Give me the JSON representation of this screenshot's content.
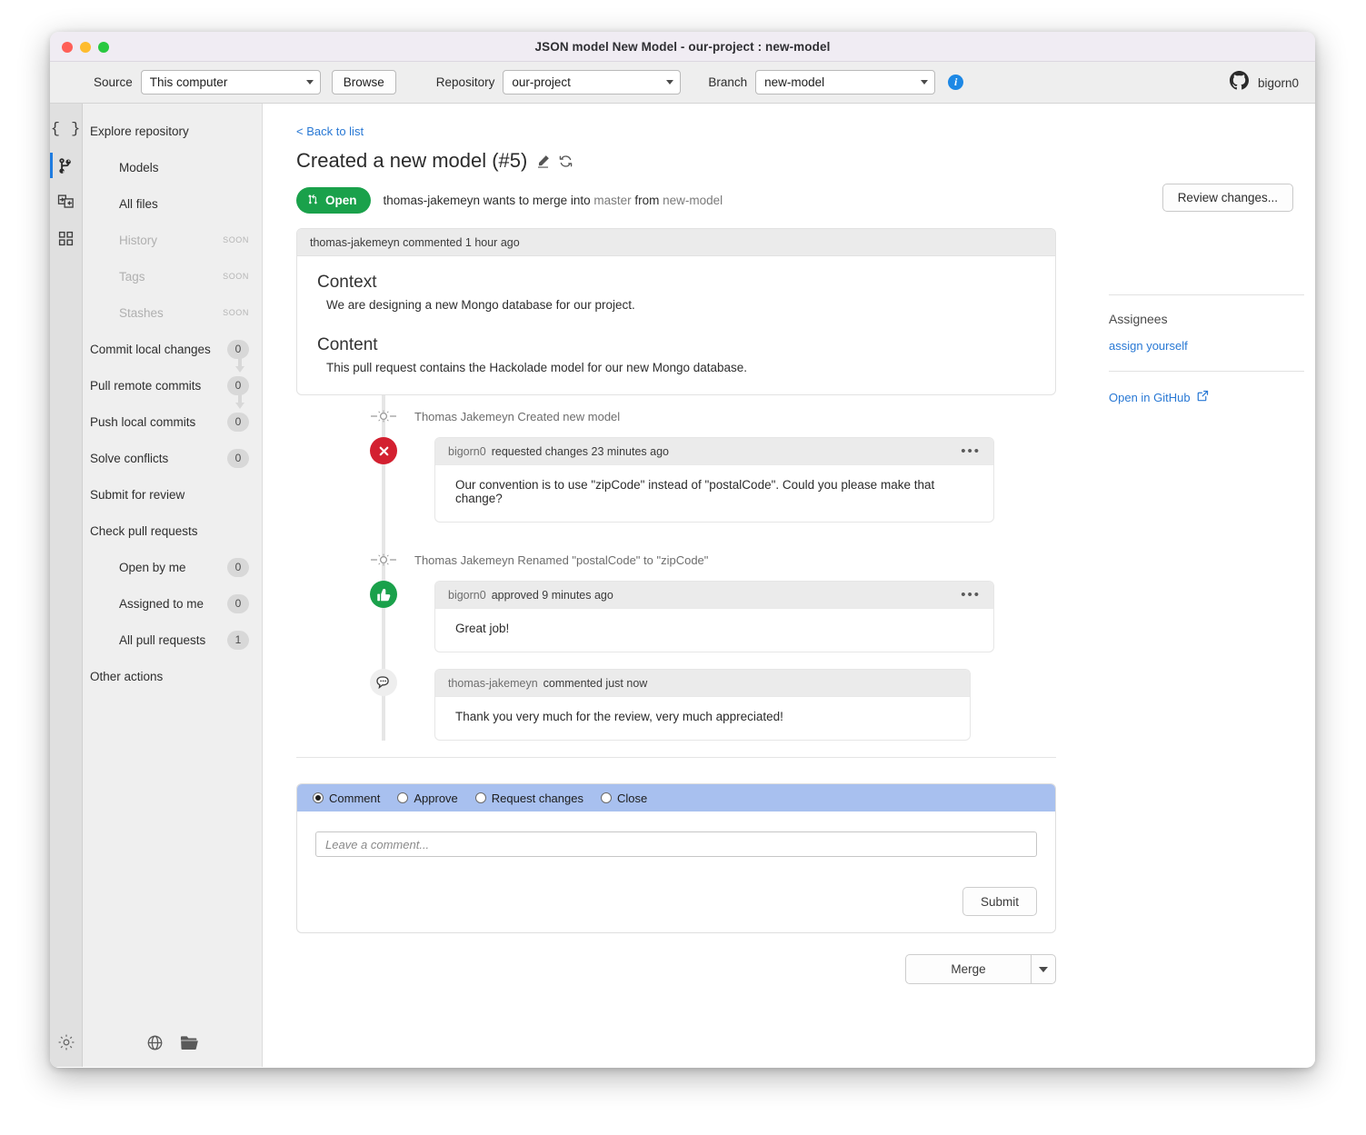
{
  "window": {
    "title": "JSON model New Model - our-project : new-model"
  },
  "toolbar": {
    "source_label": "Source",
    "source_value": "This computer",
    "browse_label": "Browse",
    "repository_label": "Repository",
    "repository_value": "our-project",
    "branch_label": "Branch",
    "branch_value": "new-model",
    "info_glyph": "i",
    "user_name": "bigorn0",
    "github_icon": "github-icon"
  },
  "rail": {
    "items": [
      {
        "name": "json-braces-icon",
        "glyph": "{ }"
      },
      {
        "name": "git-branch-icon"
      },
      {
        "name": "compare-models-icon"
      },
      {
        "name": "grid-apps-icon"
      }
    ],
    "settings_icon": "gear-icon"
  },
  "nav": {
    "items": [
      {
        "label": "Explore repository",
        "level": 0,
        "badge": null,
        "soon": false,
        "disabled": false,
        "connector": false
      },
      {
        "label": "Models",
        "level": 1,
        "badge": null,
        "soon": false,
        "disabled": false,
        "connector": false
      },
      {
        "label": "All files",
        "level": 1,
        "badge": null,
        "soon": false,
        "disabled": false,
        "connector": false
      },
      {
        "label": "History",
        "level": 1,
        "badge": null,
        "soon": true,
        "disabled": true,
        "connector": false
      },
      {
        "label": "Tags",
        "level": 1,
        "badge": null,
        "soon": true,
        "disabled": true,
        "connector": false
      },
      {
        "label": "Stashes",
        "level": 1,
        "badge": null,
        "soon": true,
        "disabled": true,
        "connector": false
      },
      {
        "label": "Commit local changes",
        "level": 0,
        "badge": "0",
        "soon": false,
        "disabled": false,
        "connector": true
      },
      {
        "label": "Pull remote commits",
        "level": 0,
        "badge": "0",
        "soon": false,
        "disabled": false,
        "connector": true
      },
      {
        "label": "Push local commits",
        "level": 0,
        "badge": "0",
        "soon": false,
        "disabled": false,
        "connector": false
      },
      {
        "label": "Solve conflicts",
        "level": 0,
        "badge": "0",
        "soon": false,
        "disabled": false,
        "connector": false
      },
      {
        "label": "Submit for review",
        "level": 0,
        "badge": null,
        "soon": false,
        "disabled": false,
        "connector": false
      },
      {
        "label": "Check pull requests",
        "level": 0,
        "badge": null,
        "soon": false,
        "disabled": false,
        "connector": false
      },
      {
        "label": "Open by me",
        "level": 1,
        "badge": "0",
        "soon": false,
        "disabled": false,
        "connector": false
      },
      {
        "label": "Assigned to me",
        "level": 1,
        "badge": "0",
        "soon": false,
        "disabled": false,
        "connector": false
      },
      {
        "label": "All pull requests",
        "level": 1,
        "badge": "1",
        "soon": false,
        "disabled": false,
        "connector": false
      },
      {
        "label": "Other actions",
        "level": 0,
        "badge": null,
        "soon": false,
        "disabled": false,
        "connector": false
      }
    ],
    "bottom_icons": [
      {
        "name": "globe-icon"
      },
      {
        "name": "folder-icon"
      }
    ]
  },
  "main": {
    "back_link": "< Back to list",
    "pr_title": "Created a new model (#5)",
    "edit_icon": "pencil-edit-icon",
    "refresh_icon": "refresh-sync-icon",
    "status_badge": "Open",
    "merge_prefix": "thomas-jakemeyn wants to merge into ",
    "merge_base": "master",
    "merge_mid": " from ",
    "merge_head": "new-model",
    "review_button": "Review changes...",
    "description": {
      "header": "thomas-jakemeyn commented 1 hour ago",
      "sections": [
        {
          "heading": "Context",
          "text": "We are designing a new Mongo database for our project."
        },
        {
          "heading": "Content",
          "text": "This pull request contains the Hackolade model for our new Mongo database."
        }
      ]
    },
    "timeline": [
      {
        "kind": "commit",
        "marker": "commit-node-icon",
        "text": "Thomas Jakemeyn Created new model"
      },
      {
        "kind": "event",
        "marker": "changes-requested-icon",
        "marker_color": "#d32030",
        "marker_glyph": "✕",
        "who": "bigorn0",
        "action": "requested changes 23 minutes ago",
        "menu": "•••",
        "body": "Our convention is to use \"zipCode\" instead of \"postalCode\". Could you please make that change?"
      },
      {
        "kind": "commit",
        "marker": "commit-node-icon",
        "text": "Thomas Jakemeyn Renamed \"postalCode\" to \"zipCode\""
      },
      {
        "kind": "event",
        "marker": "approved-thumbs-up-icon",
        "marker_color": "#1aa14b",
        "marker_glyph": "👍",
        "who": "bigorn0",
        "action": "approved 9 minutes ago",
        "menu": "•••",
        "body": "Great job!"
      },
      {
        "kind": "event",
        "marker": "comment-bubble-icon",
        "marker_color": "#eeeeee",
        "marker_glyph": "💬",
        "who": "thomas-jakemeyn",
        "action": "commented just now",
        "menu": "",
        "body": "Thank you very much for the review, very much appreciated!"
      }
    ],
    "form": {
      "options": [
        {
          "label": "Comment",
          "selected": true
        },
        {
          "label": "Approve",
          "selected": false
        },
        {
          "label": "Request changes",
          "selected": false
        },
        {
          "label": "Close",
          "selected": false
        }
      ],
      "comment_placeholder": "Leave a comment...",
      "submit_label": "Submit"
    },
    "merge": {
      "label": "Merge",
      "caret_icon": "chevron-down-icon"
    }
  },
  "rightbar": {
    "assignees_title": "Assignees",
    "assign_link": "assign yourself",
    "github_link": "Open in GitHub",
    "external_icon": "external-link-icon"
  },
  "colors": {
    "accent_green": "#1aa14b",
    "accent_red": "#d32030",
    "link_blue": "#2878d4",
    "form_header_blue": "#a8c0ef",
    "rail_active": "#1f7ce0"
  }
}
